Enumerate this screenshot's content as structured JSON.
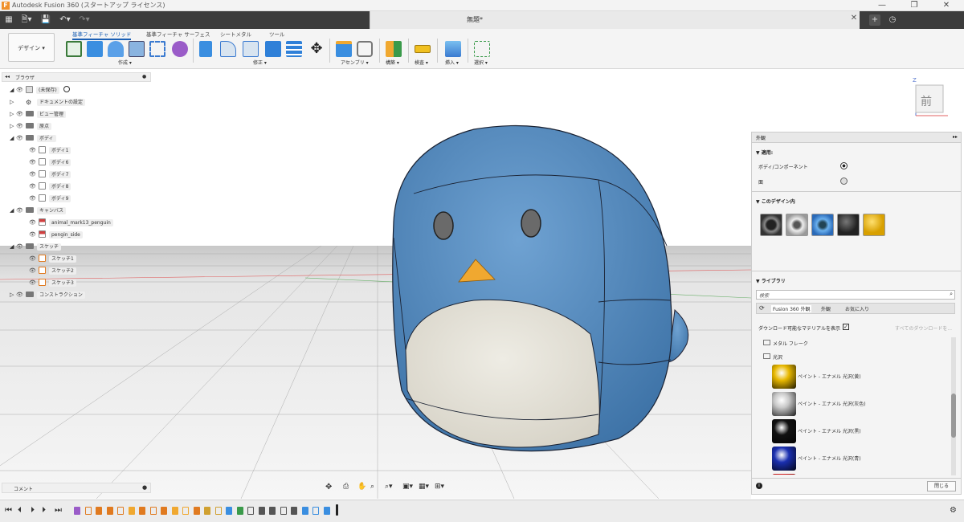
{
  "app_title": "Autodesk Fusion 360 (スタートアップ ライセンス)",
  "document_tab": "無題*",
  "workspace_label": "デザイン ▾",
  "toolbar_tabs": [
    "基準フィーチャ ソリッド",
    "基準フィーチャ サーフェス",
    "シートメタル",
    "ツール"
  ],
  "toolbar_groups": [
    "作成 ▾",
    "修正 ▾",
    "アセンブリ ▾",
    "構築 ▾",
    "検査 ▾",
    "挿入 ▾",
    "選択 ▾"
  ],
  "browser": {
    "title": "ブラウザ",
    "root": "(未保存)",
    "items": [
      {
        "label": "ドキュメントの設定",
        "level": 1,
        "type": "gear"
      },
      {
        "label": "ビュー管理",
        "level": 1,
        "type": "folder"
      },
      {
        "label": "原点",
        "level": 1,
        "type": "folder"
      },
      {
        "label": "ボディ",
        "level": 1,
        "type": "folder"
      },
      {
        "label": "ボディ1",
        "level": 2,
        "type": "body"
      },
      {
        "label": "ボディ6",
        "level": 2,
        "type": "body"
      },
      {
        "label": "ボディ7",
        "level": 2,
        "type": "body"
      },
      {
        "label": "ボディ8",
        "level": 2,
        "type": "body"
      },
      {
        "label": "ボディ9",
        "level": 2,
        "type": "body"
      },
      {
        "label": "キャンバス",
        "level": 1,
        "type": "folder"
      },
      {
        "label": "animal_mark13_penguin",
        "level": 2,
        "type": "canvas"
      },
      {
        "label": "pengin_side",
        "level": 2,
        "type": "canvas"
      },
      {
        "label": "スケッチ",
        "level": 1,
        "type": "folder"
      },
      {
        "label": "スケッチ1",
        "level": 2,
        "type": "sketch"
      },
      {
        "label": "スケッチ2",
        "level": 2,
        "type": "sketch"
      },
      {
        "label": "スケッチ3",
        "level": 2,
        "type": "sketch"
      },
      {
        "label": "コンストラクション",
        "level": 1,
        "type": "folder"
      }
    ]
  },
  "comment_label": "コメント",
  "viewcube_label": "前",
  "viewcube_axis": "Z",
  "panel": {
    "title": "外観",
    "apply_heading": "▼ 適用:",
    "option_bodies": "ボディ/コンポーネント",
    "option_faces": "面",
    "design_heading": "▼ このデザイン内",
    "library_heading": "▼ ライブラリ",
    "search_placeholder": "検索",
    "library_tabs": [
      "Fusion 360 外観",
      "外観",
      "お気に入り"
    ],
    "show_download": "ダウンロード可能なマテリアルを表示",
    "download_all": "すべてのダウンロードを...",
    "folders": [
      "メタル フレーク",
      "光沢"
    ],
    "items": [
      {
        "label": "ペイント - エナメル 光沢(黄)",
        "color": "#e8b800"
      },
      {
        "label": "ペイント - エナメル 光沢(灰色)",
        "color": "#c8c8c8"
      },
      {
        "label": "ペイント - エナメル 光沢(黒)",
        "color": "#111111"
      },
      {
        "label": "ペイント - エナメル 光沢(青)",
        "color": "#1a2fb0"
      }
    ],
    "close_button": "閉じる"
  },
  "colors": {
    "penguin_blue": "#5b8fc0",
    "belly": "#e5e2d8",
    "beak": "#f0a830",
    "accent": "#1a5fb4"
  }
}
